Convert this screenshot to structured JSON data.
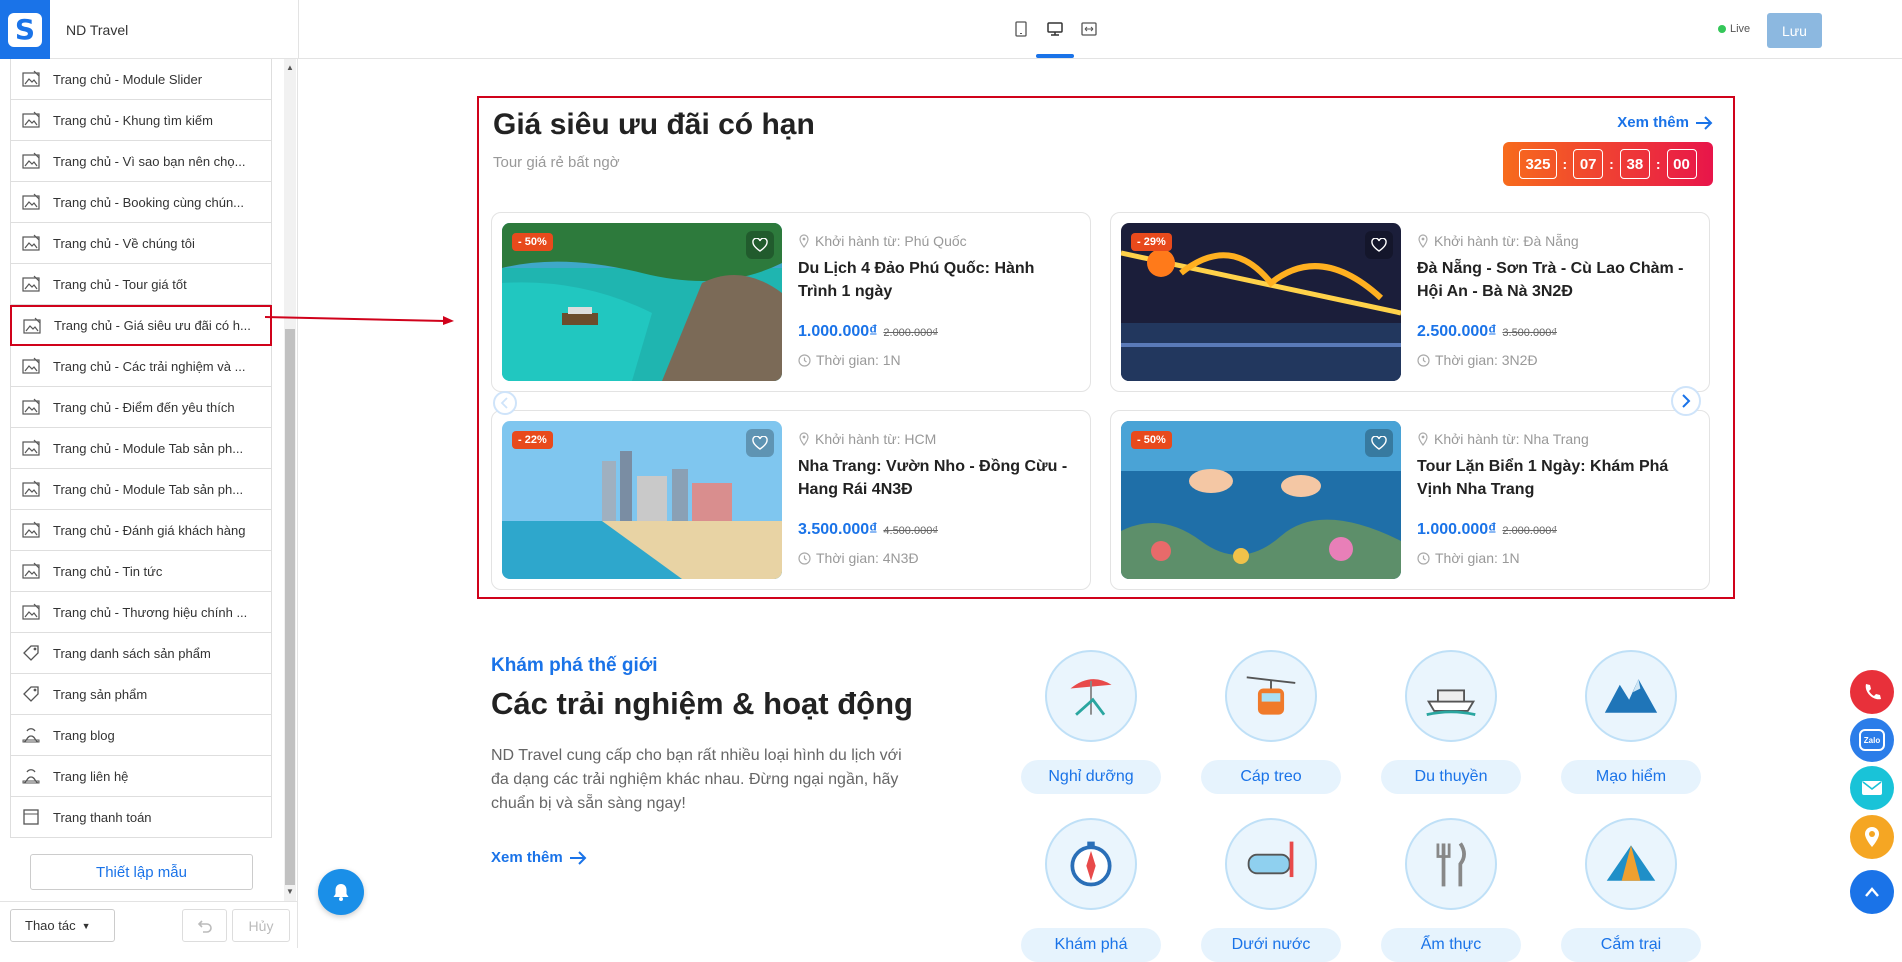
{
  "app": {
    "logo_letter": "S",
    "site_name": "ND Travel",
    "live_label": "Live",
    "save_label": "Lưu"
  },
  "devices": [
    {
      "icon": "mobile-icon"
    },
    {
      "icon": "desktop-icon",
      "active": true
    },
    {
      "icon": "fullwidth-icon"
    }
  ],
  "sidebar": {
    "items": [
      {
        "label": "Trang chủ - Module Slider",
        "icon": "section-image-icon"
      },
      {
        "label": "Trang chủ - Khung tìm kiếm",
        "icon": "section-image-icon"
      },
      {
        "label": "Trang chủ - Vì sao bạn nên chọ...",
        "icon": "section-image-icon"
      },
      {
        "label": "Trang chủ - Booking cùng chún...",
        "icon": "section-image-icon"
      },
      {
        "label": "Trang chủ - Về chúng tôi",
        "icon": "section-image-icon"
      },
      {
        "label": "Trang chủ - Tour giá tốt",
        "icon": "section-image-icon"
      },
      {
        "label": "Trang chủ - Giá siêu ưu đãi có h...",
        "icon": "section-image-icon",
        "selected": true
      },
      {
        "label": "Trang chủ - Các trải nghiệm và ...",
        "icon": "section-image-icon"
      },
      {
        "label": "Trang chủ - Điểm đến yêu thích",
        "icon": "section-image-icon"
      },
      {
        "label": "Trang chủ - Module Tab sản ph...",
        "icon": "section-image-icon"
      },
      {
        "label": "Trang chủ - Module Tab sản ph...",
        "icon": "section-image-icon"
      },
      {
        "label": "Trang chủ - Đánh giá khách hàng",
        "icon": "section-image-icon"
      },
      {
        "label": "Trang chủ - Tin tức",
        "icon": "section-image-icon"
      },
      {
        "label": "Trang chủ - Thương hiệu chính ...",
        "icon": "section-image-icon"
      },
      {
        "label": "Trang danh sách sản phẩm",
        "icon": "tag-icon"
      },
      {
        "label": "Trang sản phẩm",
        "icon": "tag-icon"
      },
      {
        "label": "Trang blog",
        "icon": "blog-icon"
      },
      {
        "label": "Trang liên hệ",
        "icon": "contact-icon"
      },
      {
        "label": "Trang thanh toán",
        "icon": "checkout-icon"
      }
    ],
    "setup_label": "Thiết lập mẫu",
    "action_label": "Thao tác",
    "cancel_label": "Hủy"
  },
  "deal": {
    "title": "Giá siêu ưu đãi có hạn",
    "subtitle": "Tour giá rẻ bất ngờ",
    "see_more": "Xem thêm",
    "countdown": [
      "325",
      "07",
      "38",
      "00"
    ],
    "countdown_sep": ":",
    "cards": [
      {
        "discount": "- 50%",
        "departure": "Khởi hành từ: Phú Quốc",
        "name": "Du Lịch 4 Đảo Phú Quốc: Hành Trình 1 ngày",
        "price": "1.000.000₫",
        "old_price": "2.000.000₫",
        "duration": "Thời gian: 1N",
        "image": "island-beach"
      },
      {
        "discount": "- 29%",
        "departure": "Khởi hành từ: Đà Nẵng",
        "name": "Đà Nẵng - Sơn Trà - Cù Lao Chàm - Hội An - Bà Nà 3N2Đ",
        "price": "2.500.000₫",
        "old_price": "3.500.000₫",
        "duration": "Thời gian: 3N2Đ",
        "image": "dragon-bridge-night"
      },
      {
        "discount": "- 22%",
        "departure": "Khởi hành từ: HCM",
        "name": "Nha Trang: Vườn Nho - Đồng Cừu - Hang Rái 4N3Đ",
        "price": "3.500.000₫",
        "old_price": "4.500.000₫",
        "duration": "Thời gian: 4N3Đ",
        "image": "city-beach"
      },
      {
        "discount": "- 50%",
        "departure": "Khởi hành từ: Nha Trang",
        "name": "Tour Lặn Biển 1 Ngày: Khám Phá Vịnh Nha Trang",
        "price": "1.000.000₫",
        "old_price": "2.000.000₫",
        "duration": "Thời gian: 1N",
        "image": "snorkel-reef"
      }
    ]
  },
  "experiences": {
    "kicker": "Khám phá thế giới",
    "title": "Các trải nghiệm & hoạt động",
    "description": "ND Travel cung cấp cho bạn rất nhiều loại hình du lịch với đa dạng các trải nghiệm khác nhau. Đừng ngại ngần, hãy chuẩn bị và sẵn sàng ngay!",
    "see_more": "Xem thêm",
    "items": [
      {
        "label": "Nghỉ dưỡng",
        "icon": "beach-chair-icon"
      },
      {
        "label": "Cáp treo",
        "icon": "cable-car-icon"
      },
      {
        "label": "Du thuyền",
        "icon": "cruise-ship-icon"
      },
      {
        "label": "Mạo hiểm",
        "icon": "mountain-icon"
      },
      {
        "label": "Khám phá",
        "icon": "compass-icon"
      },
      {
        "label": "Dưới nước",
        "icon": "diving-mask-icon"
      },
      {
        "label": "Ẩm thực",
        "icon": "cutlery-icon"
      },
      {
        "label": "Cắm trại",
        "icon": "tent-icon"
      }
    ]
  },
  "floating": [
    {
      "icon": "phone-icon",
      "color": "#e8303a"
    },
    {
      "icon": "zalo-icon",
      "color": "#2b7de9",
      "text": "Zalo"
    },
    {
      "icon": "mail-icon",
      "color": "#19c3d8"
    },
    {
      "icon": "location-icon",
      "color": "#f5a623"
    },
    {
      "icon": "scroll-top-icon",
      "color": "#1a73e8"
    }
  ],
  "colors": {
    "accent": "#1a73e8",
    "highlight": "#d0021b",
    "price": "#1a73e8"
  }
}
